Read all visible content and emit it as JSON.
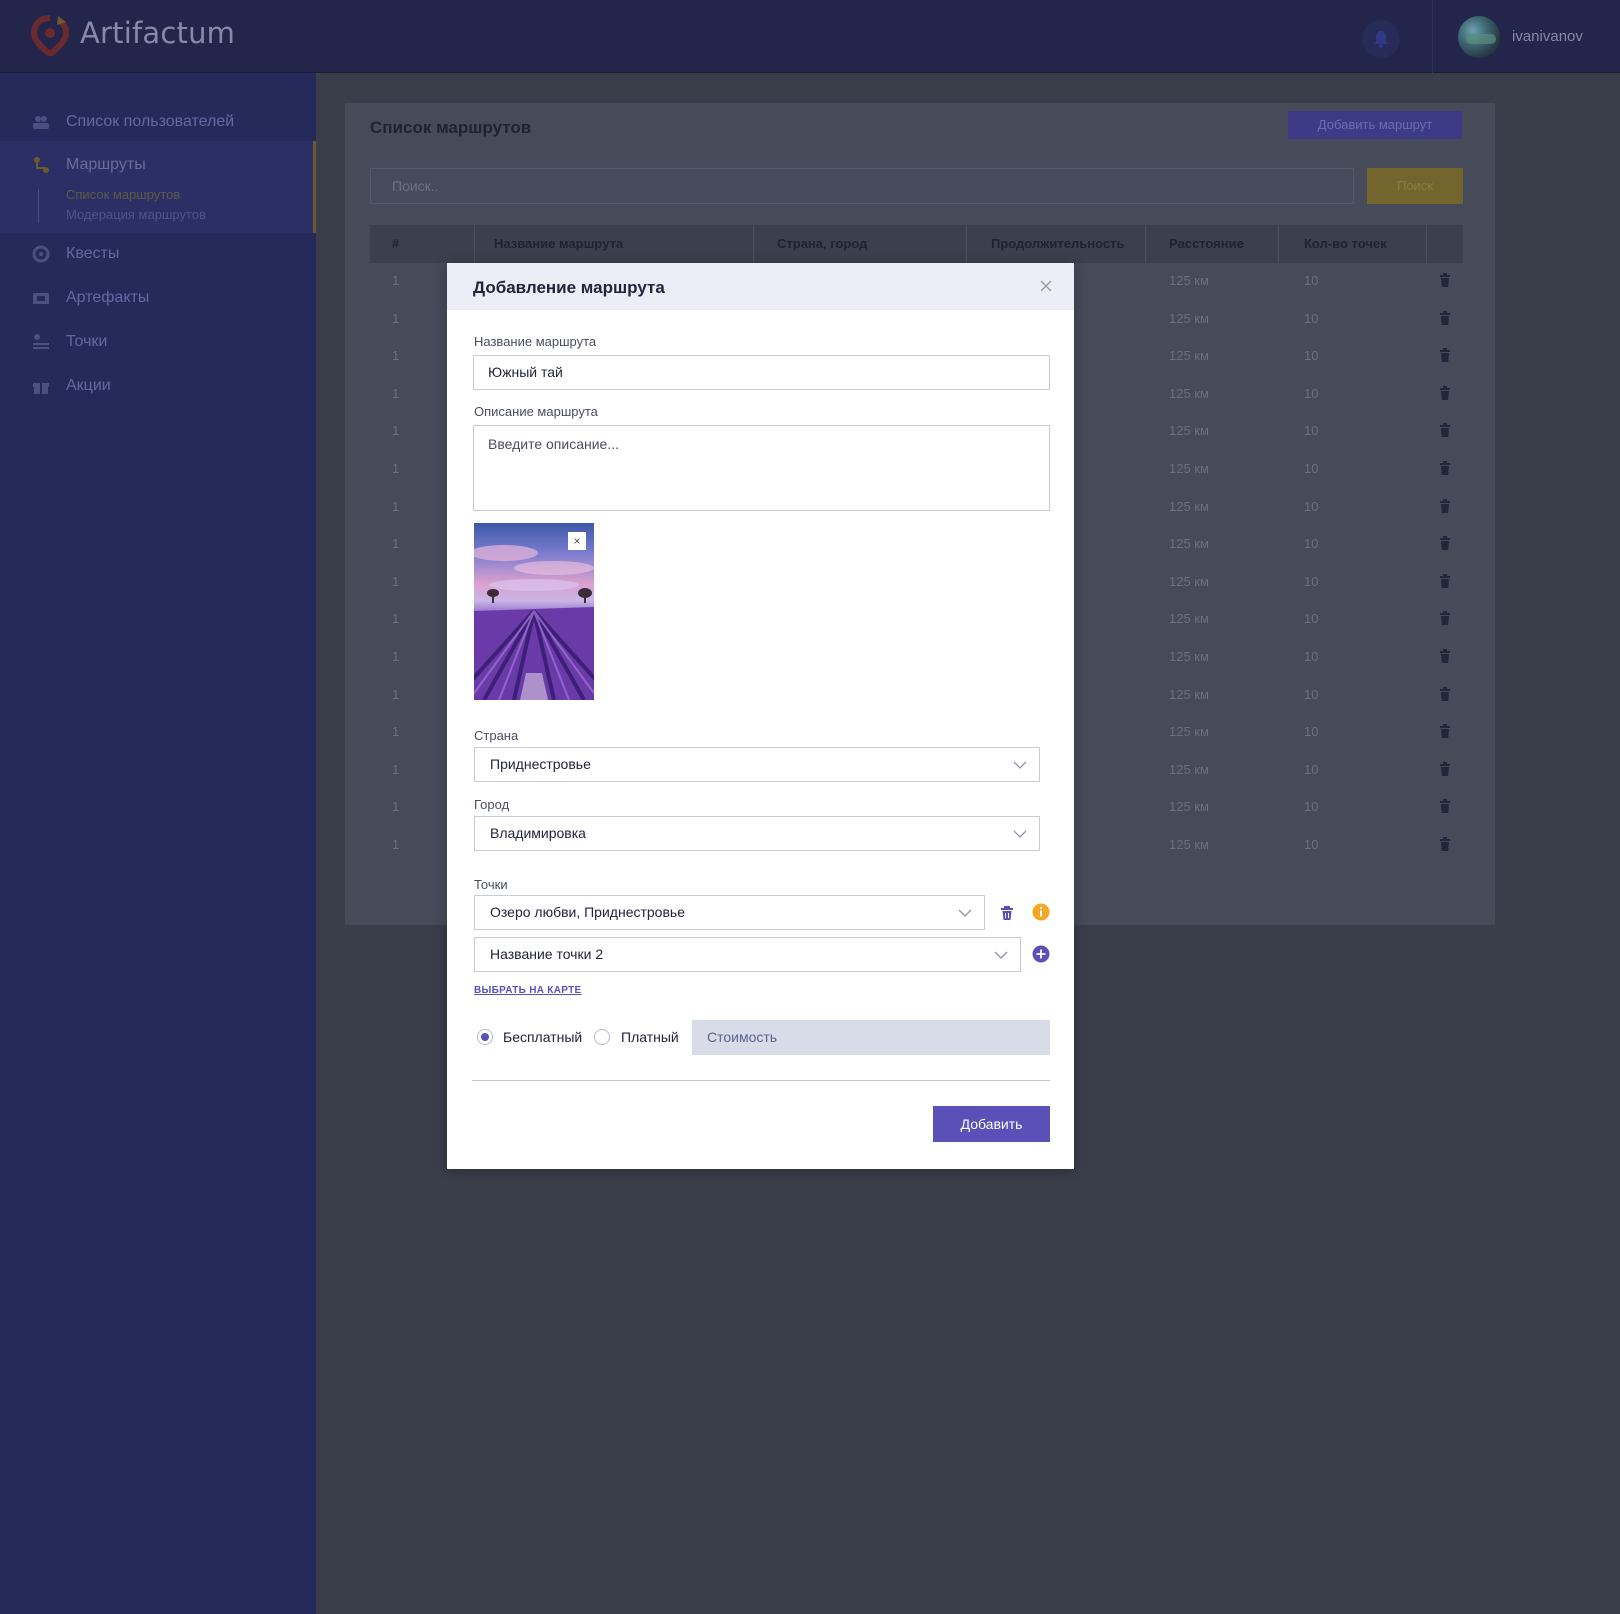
{
  "app": {
    "brand": "Artifactum",
    "username": "ivanivanov"
  },
  "sidebar": {
    "items": [
      {
        "label": "Список пользователей",
        "icon": "users-icon"
      },
      {
        "label": "Маршруты",
        "icon": "route-icon"
      },
      {
        "label": "Квесты",
        "icon": "quest-icon"
      },
      {
        "label": "Артефакты",
        "icon": "artifact-icon"
      },
      {
        "label": "Точки",
        "icon": "points-icon"
      },
      {
        "label": "Акции",
        "icon": "gift-icon"
      }
    ],
    "subitems": [
      "Список маршрутов",
      "Модерация маршрутов"
    ]
  },
  "page": {
    "title": "Список маршрутов",
    "add_button": "Добавить маршрут",
    "search_placeholder": "Поиск..",
    "search_button": "Поиск"
  },
  "table": {
    "columns": [
      "#",
      "Название маршрута",
      "Страна, город",
      "Продолжительность",
      "Расстояние",
      "Кол-во точек"
    ],
    "rows": [
      {
        "num": "1",
        "distance": "125 км",
        "points": "10"
      },
      {
        "num": "1",
        "distance": "125 км",
        "points": "10"
      },
      {
        "num": "1",
        "distance": "125 км",
        "points": "10"
      },
      {
        "num": "1",
        "distance": "125 км",
        "points": "10"
      },
      {
        "num": "1",
        "distance": "125 км",
        "points": "10"
      },
      {
        "num": "1",
        "distance": "125 км",
        "points": "10"
      },
      {
        "num": "1",
        "distance": "125 км",
        "points": "10"
      },
      {
        "num": "1",
        "distance": "125 км",
        "points": "10"
      },
      {
        "num": "1",
        "distance": "125 км",
        "points": "10"
      },
      {
        "num": "1",
        "distance": "125 км",
        "points": "10"
      },
      {
        "num": "1",
        "distance": "125 км",
        "points": "10"
      },
      {
        "num": "1",
        "distance": "125 км",
        "points": "10"
      },
      {
        "num": "1",
        "distance": "125 км",
        "points": "10"
      },
      {
        "num": "1",
        "distance": "125 км",
        "points": "10"
      },
      {
        "num": "1",
        "distance": "125 км",
        "points": "10"
      },
      {
        "num": "1",
        "distance": "125 км",
        "points": "10"
      }
    ]
  },
  "modal": {
    "title": "Добавление маршрута",
    "name_label": "Название маршрута",
    "name_value": "Южный тай",
    "description_label": "Описание маршрута",
    "description_placeholder": "Введите описание...",
    "photo_close": "×",
    "country_label": "Страна",
    "country_value": "Приднестровье",
    "city_label": "Город",
    "city_value": "Владимировка",
    "points_label": "Точки",
    "point1_value": "Озеро любви, Приднестровье",
    "point2_value": "Название точки 2",
    "map_link": "ВЫБРАТЬ НА КАРТЕ",
    "free_label": "Бесплатный",
    "paid_label": "Платный",
    "payment_selected": "free",
    "cost_placeholder": "Стоимость",
    "submit": "Добавить"
  },
  "colors": {
    "accent": "#5a50b8",
    "warning": "#f5a623",
    "sidebar_bg": "#262a5a",
    "topbar_bg": "#23264a"
  }
}
